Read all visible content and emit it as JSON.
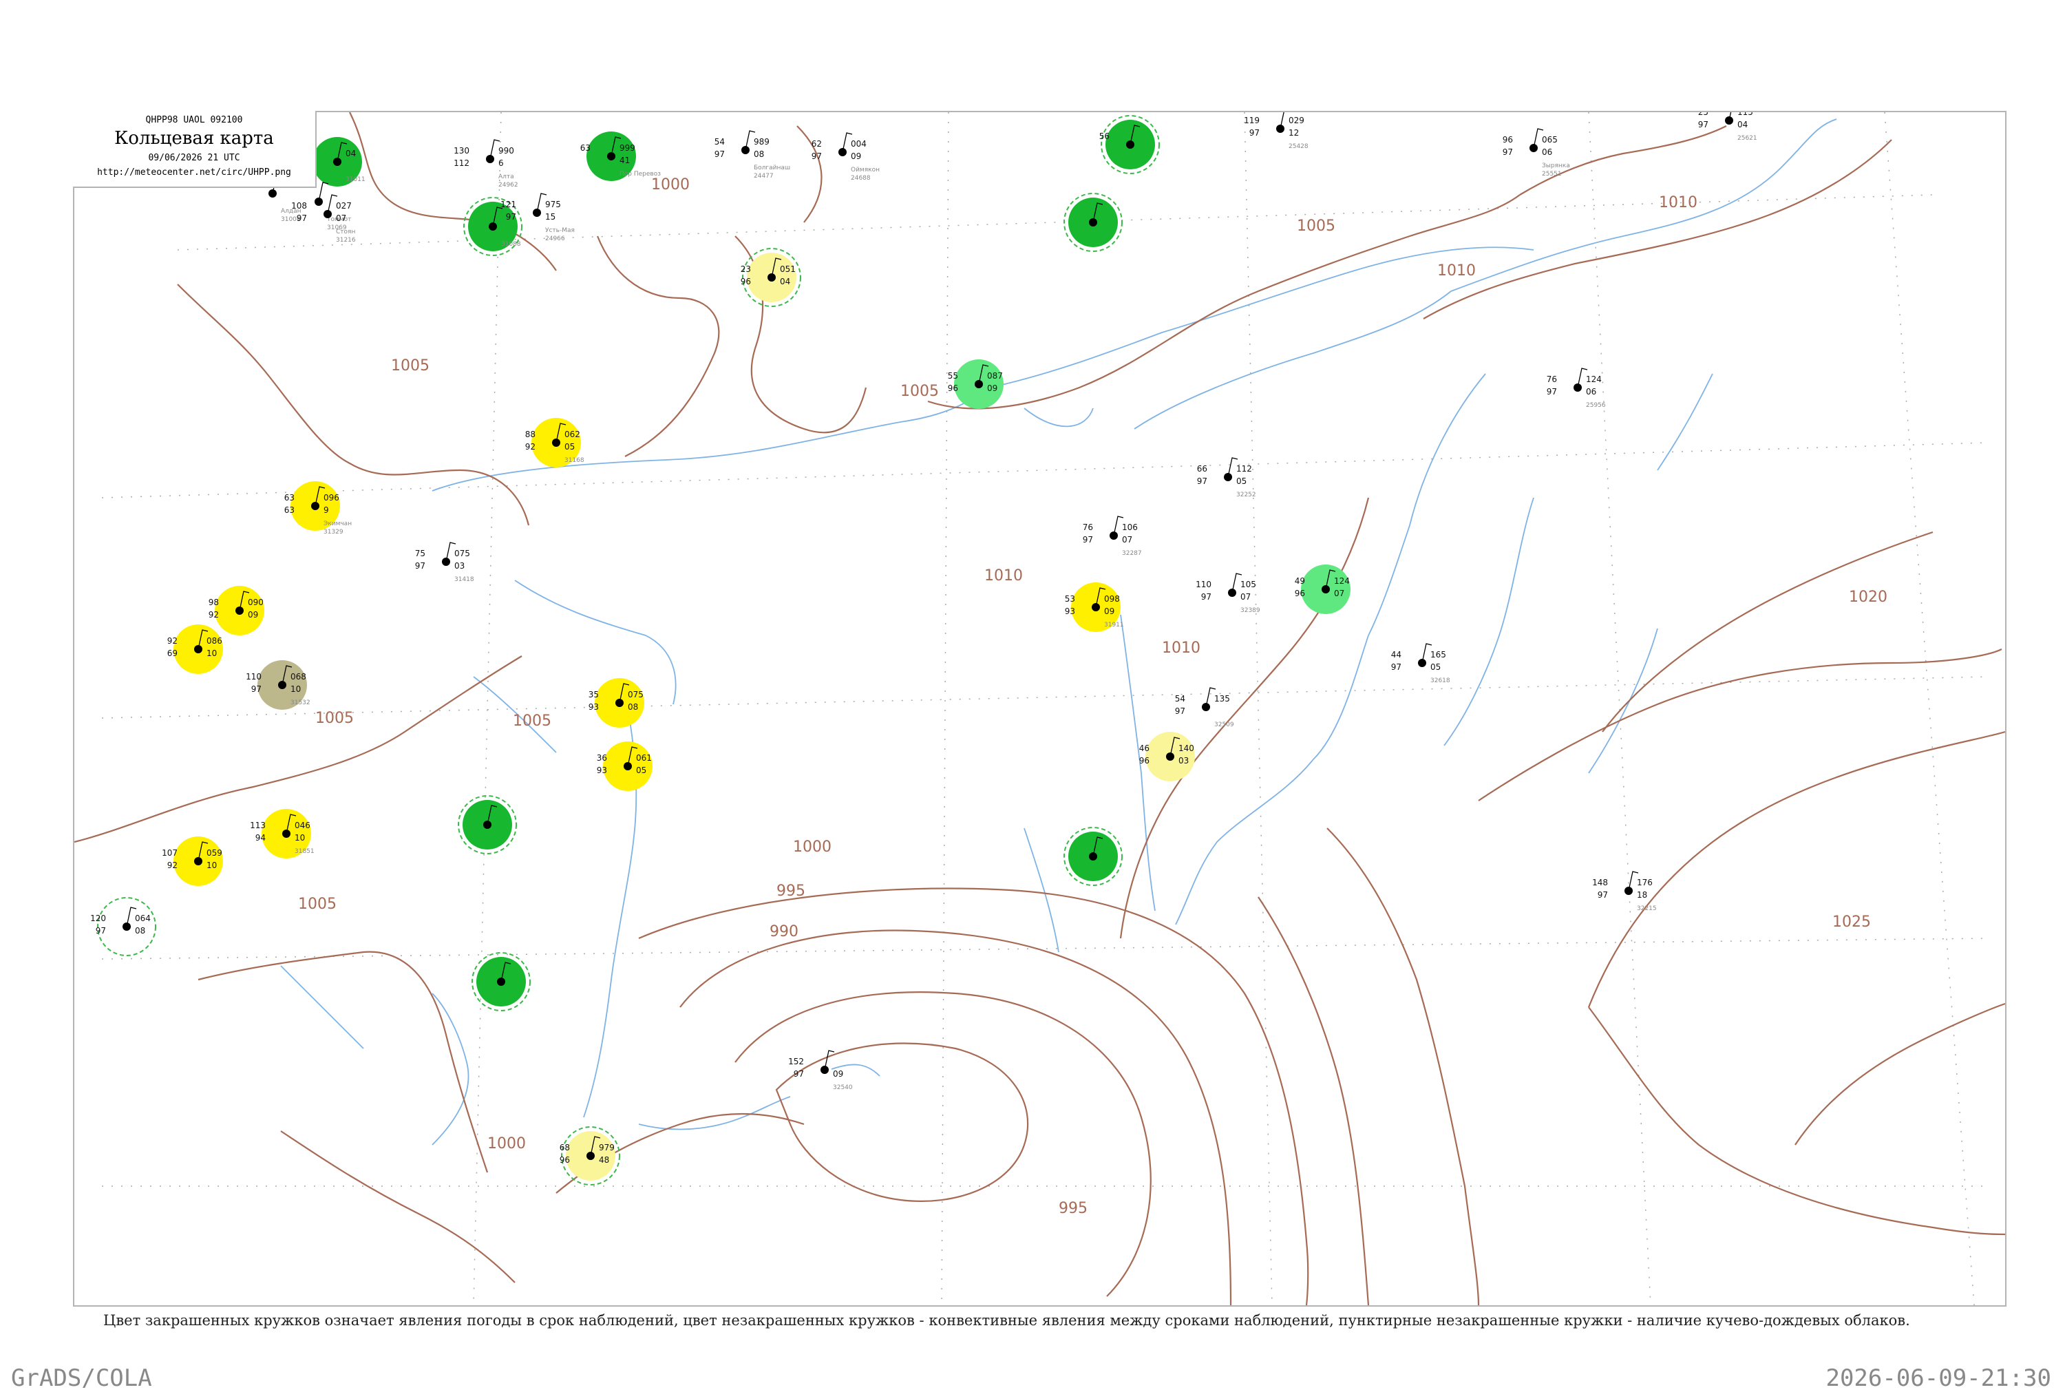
{
  "header": {
    "code": "QHPP98  UAOL  092100",
    "title": "Кольцевая карта",
    "date": "09/06/2026 21 UTC",
    "link": "http://meteocenter.net/circ/UHPP.png"
  },
  "legend_note": "Цвет закрашенных кружков означает явления погоды в срок наблюдений, цвет незакрашенных кружков - конвективные явления между сроками наблюдений, пунктирные незакрашенные кружки - наличие кучево-дождевых облаков.",
  "footer": {
    "left": "GrADS/COLA",
    "right": "2026-06-09-21:30"
  },
  "colors": {
    "isobar": "#a66a55",
    "coast": "#7fb3e6",
    "frame": "#b4b4b4",
    "phenomena_green": "#17b830",
    "phenomena_lightgreen": "#5fe880",
    "phenomena_yellow": "#fff000",
    "phenomena_paleyellow": "#fbf59a",
    "phenomena_olive": "#bdb78c",
    "cb_ring": "#3cb84a"
  },
  "isobar_labels": [
    "1000",
    "1005",
    "1005",
    "1005",
    "1005",
    "1005",
    "1005",
    "1010",
    "1010",
    "1010",
    "1010",
    "1020",
    "1025",
    "1000",
    "995",
    "990",
    "1000",
    "995"
  ],
  "stations": [
    {
      "id": "31011",
      "name": "",
      "fill": "green",
      "ring": "none",
      "tl": "75",
      "tr": "04",
      "bl": "003",
      "br": ""
    },
    {
      "id": "24962",
      "name": "Алта",
      "fill": "none",
      "ring": "none",
      "tl": "130",
      "tr": "990",
      "bl": "112",
      "br": "6"
    },
    {
      "id": "",
      "name": "Пор Перевоз",
      "fill": "green",
      "ring": "none",
      "tl": "63",
      "tr": "999",
      "bl": "",
      "br": "41"
    },
    {
      "id": "24477",
      "name": "Болгайнаш",
      "fill": "none",
      "ring": "none",
      "tl": "54",
      "tr": "989",
      "bl": "97",
      "br": "08"
    },
    {
      "id": "24688",
      "name": "Оймякон",
      "fill": "none",
      "ring": "none",
      "tl": "62",
      "tr": "004",
      "bl": "97",
      "br": "09"
    },
    {
      "id": "",
      "name": "",
      "fill": "green",
      "ring": "dashed",
      "tl": "56",
      "tr": "",
      "bl": "",
      "br": ""
    },
    {
      "id": "25428",
      "name": "",
      "fill": "none",
      "ring": "none",
      "tl": "119",
      "tr": "029",
      "bl": "97",
      "br": "12"
    },
    {
      "id": "25621",
      "name": "",
      "fill": "none",
      "ring": "none",
      "tl": "25",
      "tr": "115",
      "bl": "97",
      "br": "04"
    },
    {
      "id": "25551",
      "name": "Зырянка",
      "fill": "none",
      "ring": "none",
      "tl": "96",
      "tr": "065",
      "bl": "97",
      "br": "06"
    },
    {
      "id": "31088",
      "name": "",
      "fill": "green",
      "ring": "dashed",
      "tl": "",
      "tr": "",
      "bl": "",
      "br": ""
    },
    {
      "id": "",
      "name": "",
      "fill": "green",
      "ring": "dashed",
      "tl": "",
      "tr": "",
      "bl": "",
      "br": ""
    },
    {
      "id": "24966",
      "name": "Усть-Мая",
      "fill": "none",
      "ring": "none",
      "tl": "121",
      "tr": "975",
      "bl": "97",
      "br": "15"
    },
    {
      "id": "31004",
      "name": "Алдан",
      "fill": "none",
      "ring": "none",
      "tl": "",
      "tr": "",
      "bl": "",
      "br": ""
    },
    {
      "id": "31069",
      "name": "Томмот",
      "fill": "none",
      "ring": "none",
      "tl": "",
      "tr": "",
      "bl": "",
      "br": ""
    },
    {
      "id": "31216",
      "name": "Стоян",
      "fill": "none",
      "ring": "none",
      "tl": "108",
      "tr": "027",
      "bl": "97",
      "br": "07"
    },
    {
      "id": "31168",
      "name": "",
      "fill": "yellow",
      "ring": "none",
      "tl": "88",
      "tr": "062",
      "bl": "92",
      "br": "05"
    },
    {
      "id": "31329",
      "name": "Экимчан",
      "fill": "yellow",
      "ring": "none",
      "tl": "63",
      "tr": "096",
      "bl": "63",
      "br": "9"
    },
    {
      "id": "",
      "name": "",
      "fill": "lightgreen",
      "ring": "none",
      "tl": "55",
      "tr": "087",
      "bl": "96",
      "br": "09"
    },
    {
      "id": "31418",
      "name": "",
      "fill": "none",
      "ring": "none",
      "tl": "75",
      "tr": "075",
      "bl": "97",
      "br": "03"
    },
    {
      "id": "",
      "name": "",
      "fill": "paleyellow",
      "ring": "dashed",
      "tl": "23",
      "tr": "051",
      "bl": "96",
      "br": "04"
    },
    {
      "id": "31911",
      "name": "",
      "fill": "yellow",
      "ring": "none",
      "tl": "53",
      "tr": "098",
      "bl": "93",
      "br": "09"
    },
    {
      "id": "",
      "name": "",
      "fill": "lightgreen",
      "ring": "none",
      "tl": "49",
      "tr": "124",
      "bl": "96",
      "br": "07"
    },
    {
      "id": "31532",
      "name": "",
      "fill": "olive",
      "ring": "none",
      "tl": "110",
      "tr": "068",
      "bl": "97",
      "br": "10"
    },
    {
      "id": "",
      "name": "",
      "fill": "yellow",
      "ring": "none",
      "tl": "98",
      "tr": "090",
      "bl": "92",
      "br": "09"
    },
    {
      "id": "",
      "name": "",
      "fill": "yellow",
      "ring": "none",
      "tl": "92",
      "tr": "086",
      "bl": "69",
      "br": "10"
    },
    {
      "id": "",
      "name": "",
      "fill": "yellow",
      "ring": "none",
      "tl": "35",
      "tr": "075",
      "bl": "93",
      "br": "08"
    },
    {
      "id": "",
      "name": "",
      "fill": "yellow",
      "ring": "none",
      "tl": "36",
      "tr": "061",
      "bl": "93",
      "br": "05"
    },
    {
      "id": "",
      "name": "",
      "fill": "paleyellow",
      "ring": "none",
      "tl": "46",
      "tr": "140",
      "bl": "96",
      "br": "03"
    },
    {
      "id": "31851",
      "name": "",
      "fill": "yellow",
      "ring": "none",
      "tl": "113",
      "tr": "046",
      "bl": "94",
      "br": "10"
    },
    {
      "id": "",
      "name": "",
      "fill": "yellow",
      "ring": "none",
      "tl": "107",
      "tr": "059",
      "bl": "92",
      "br": "10"
    },
    {
      "id": "",
      "name": "",
      "fill": "green",
      "ring": "dashed",
      "tl": "",
      "tr": "",
      "bl": "",
      "br": ""
    },
    {
      "id": "",
      "name": "",
      "fill": "green",
      "ring": "dashed",
      "tl": "",
      "tr": "",
      "bl": "",
      "br": ""
    },
    {
      "id": "",
      "name": "",
      "fill": "green",
      "ring": "dashed",
      "tl": "",
      "tr": "",
      "bl": "",
      "br": ""
    },
    {
      "id": "",
      "name": "",
      "fill": "paleyellow",
      "ring": "dashed",
      "tl": "68",
      "tr": "979",
      "bl": "96",
      "br": "48"
    },
    {
      "id": "",
      "name": "",
      "fill": "none",
      "ring": "dashed",
      "tl": "120",
      "tr": "064",
      "bl": "97",
      "br": "08"
    },
    {
      "id": "32540",
      "name": "",
      "fill": "none",
      "ring": "none",
      "tl": "152",
      "tr": "",
      "bl": "97",
      "br": "09"
    },
    {
      "id": "32215",
      "name": "",
      "fill": "none",
      "ring": "none",
      "tl": "148",
      "tr": "176",
      "bl": "97",
      "br": "18"
    },
    {
      "id": "32618",
      "name": "",
      "fill": "none",
      "ring": "none",
      "tl": "44",
      "tr": "165",
      "bl": "97",
      "br": "05"
    },
    {
      "id": "32509",
      "name": "",
      "fill": "none",
      "ring": "none",
      "tl": "54",
      "tr": "135",
      "bl": "97",
      "br": ""
    },
    {
      "id": "32252",
      "name": "",
      "fill": "none",
      "ring": "none",
      "tl": "66",
      "tr": "112",
      "bl": "97",
      "br": "05"
    },
    {
      "id": "32287",
      "name": "",
      "fill": "none",
      "ring": "none",
      "tl": "76",
      "tr": "106",
      "bl": "97",
      "br": "07"
    },
    {
      "id": "32389",
      "name": "",
      "fill": "none",
      "ring": "none",
      "tl": "110",
      "tr": "105",
      "bl": "97",
      "br": "07"
    },
    {
      "id": "25956",
      "name": "",
      "fill": "none",
      "ring": "none",
      "tl": "76",
      "tr": "124",
      "bl": "97",
      "br": "06"
    }
  ]
}
